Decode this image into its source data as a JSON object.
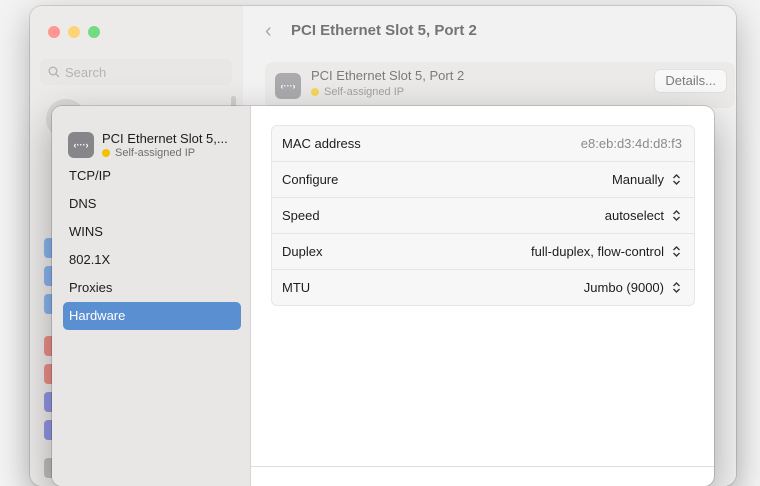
{
  "search": {
    "placeholder": "Search"
  },
  "header": {
    "title": "PCI Ethernet Slot 5, Port 2"
  },
  "card": {
    "title": "PCI Ethernet Slot 5, Port 2",
    "status": "Self-assigned IP",
    "details_label": "Details...",
    "icon_glyph": "‹···›"
  },
  "sheet": {
    "service_title": "PCI Ethernet Slot 5,...",
    "service_status": "Self-assigned IP",
    "icon_glyph": "‹···›",
    "nav": [
      {
        "label": "TCP/IP"
      },
      {
        "label": "DNS"
      },
      {
        "label": "WINS"
      },
      {
        "label": "802.1X"
      },
      {
        "label": "Proxies"
      },
      {
        "label": "Hardware",
        "active": true
      }
    ],
    "hardware": {
      "mac": {
        "label": "MAC address",
        "value": "e8:eb:d3:4d:d8:f3"
      },
      "configure": {
        "label": "Configure",
        "value": "Manually"
      },
      "speed": {
        "label": "Speed",
        "value": "autoselect"
      },
      "duplex": {
        "label": "Duplex",
        "value": "full-duplex, flow-control"
      },
      "mtu": {
        "label": "MTU",
        "value": "Jumbo (9000)"
      }
    }
  },
  "colors": {
    "accent": "#5a8fd1",
    "status_yellow": "#f2c100"
  }
}
